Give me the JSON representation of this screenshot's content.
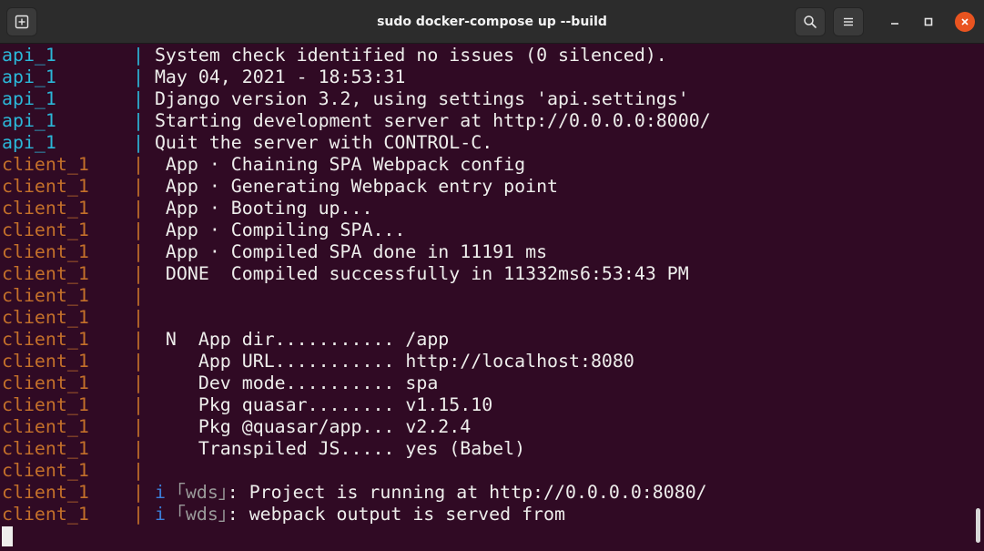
{
  "window": {
    "title": "sudo docker-compose up --build"
  },
  "icons": {
    "new_tab": "new-tab-icon",
    "search": "search-icon",
    "menu": "hamburger-menu-icon",
    "minimize": "minimize-icon",
    "maximize": "maximize-icon",
    "close": "close-icon"
  },
  "colors": {
    "terminal_background": "#300a24",
    "api_service": "#2bb7d8",
    "client_service": "#c4702a",
    "close_button": "#e95420"
  },
  "terminal": {
    "lines": [
      {
        "service": "api_1",
        "kind": "api",
        "sep": "| ",
        "text": "System check identified no issues (0 silenced)."
      },
      {
        "service": "api_1",
        "kind": "api",
        "sep": "| ",
        "text": "May 04, 2021 - 18:53:31"
      },
      {
        "service": "api_1",
        "kind": "api",
        "sep": "| ",
        "text": "Django version 3.2, using settings 'api.settings'"
      },
      {
        "service": "api_1",
        "kind": "api",
        "sep": "| ",
        "text": "Starting development server at http://0.0.0.0:8000/"
      },
      {
        "service": "api_1",
        "kind": "api",
        "sep": "| ",
        "text": "Quit the server with CONTROL-C."
      },
      {
        "service": "client_1",
        "kind": "client",
        "sep": "| ",
        "text": " App · Chaining SPA Webpack config"
      },
      {
        "service": "client_1",
        "kind": "client",
        "sep": "| ",
        "text": " App · Generating Webpack entry point"
      },
      {
        "service": "client_1",
        "kind": "client",
        "sep": "| ",
        "text": " App · Booting up..."
      },
      {
        "service": "client_1",
        "kind": "client",
        "sep": "| ",
        "text": " App · Compiling SPA..."
      },
      {
        "service": "client_1",
        "kind": "client",
        "sep": "| ",
        "text": " App · Compiled SPA done in 11191 ms"
      },
      {
        "service": "client_1",
        "kind": "client",
        "sep": "| ",
        "text": " DONE  Compiled successfully in 11332ms6:53:43 PM"
      },
      {
        "service": "client_1",
        "kind": "client",
        "sep": "| ",
        "text": ""
      },
      {
        "service": "client_1",
        "kind": "client",
        "sep": "| ",
        "text": ""
      },
      {
        "service": "client_1",
        "kind": "client",
        "sep": "| ",
        "text": " N  App dir........... /app"
      },
      {
        "service": "client_1",
        "kind": "client",
        "sep": "| ",
        "text": "    App URL........... http://localhost:8080"
      },
      {
        "service": "client_1",
        "kind": "client",
        "sep": "| ",
        "text": "    Dev mode.......... spa"
      },
      {
        "service": "client_1",
        "kind": "client",
        "sep": "| ",
        "text": "    Pkg quasar........ v1.15.10"
      },
      {
        "service": "client_1",
        "kind": "client",
        "sep": "| ",
        "text": "    Pkg @quasar/app... v2.2.4"
      },
      {
        "service": "client_1",
        "kind": "client",
        "sep": "| ",
        "text": "    Transpiled JS..... yes (Babel)"
      },
      {
        "service": "client_1",
        "kind": "client",
        "sep": "| ",
        "text": ""
      },
      {
        "service": "client_1",
        "kind": "client",
        "sep": "| ",
        "prefix": "i",
        "tag": "｢wds｣",
        "text": ": Project is running at http://0.0.0.0:8080/"
      },
      {
        "service": "client_1",
        "kind": "client",
        "sep": "| ",
        "prefix": "i",
        "tag": "｢wds｣",
        "text": ": webpack output is served from"
      }
    ]
  }
}
